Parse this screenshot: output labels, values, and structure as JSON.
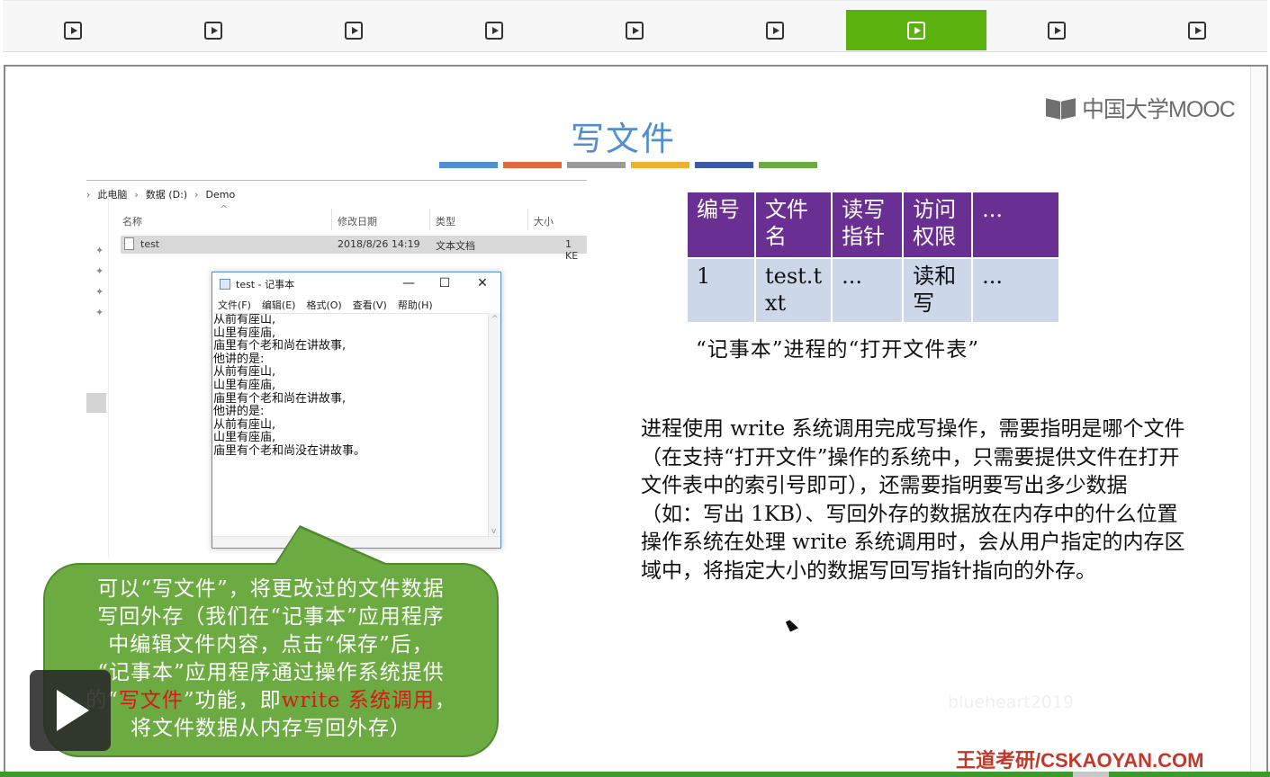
{
  "toolbar": {
    "buttons": [
      {
        "icon": "play-icon",
        "active": false
      },
      {
        "icon": "play-icon",
        "active": false
      },
      {
        "icon": "play-icon",
        "active": false
      },
      {
        "icon": "play-icon",
        "active": false
      },
      {
        "icon": "play-icon",
        "active": false
      },
      {
        "icon": "play-icon",
        "active": false
      },
      {
        "icon": "play-icon",
        "active": true
      },
      {
        "icon": "play-icon",
        "active": false
      },
      {
        "icon": "play-icon",
        "active": false
      }
    ],
    "active_color": "#5bb20e"
  },
  "slide": {
    "title": "写文件",
    "title_color": "#4f8fd0",
    "title_bar_colors": [
      "#4f8fd0",
      "#e06a3c",
      "#9a9a9a",
      "#f0b030",
      "#3a5aa8",
      "#6cab42"
    ],
    "logo": "中国大学MOOC",
    "explorer": {
      "breadcrumb": [
        "此电脑",
        "数据 (D:)",
        "Demo"
      ],
      "columns": {
        "name": "名称",
        "modified": "修改日期",
        "type": "类型",
        "size": "大小"
      },
      "file": {
        "name": "test",
        "modified": "2018/8/26 14:19",
        "type": "文本文档",
        "size": "1 KE"
      }
    },
    "notepad": {
      "title": "test - 记事本",
      "menu": [
        "文件(F)",
        "编辑(E)",
        "格式(O)",
        "查看(V)",
        "帮助(H)"
      ],
      "controls": {
        "minimize": "—",
        "maximize": "☐",
        "close": "✕"
      },
      "content": "从前有座山,\n山里有座庙,\n庙里有个老和尚在讲故事,\n他讲的是:\n从前有座山,\n山里有座庙,\n庙里有个老和尚在讲故事,\n他讲的是:\n从前有座山,\n山里有座庙,\n庙里有个老和尚没在讲故事。"
    },
    "callout": {
      "line1": "可以“写文件”，将更改过的文件数据",
      "line2": "写回外存（我们在“记事本”应用程序",
      "line3": "中编辑文件内容，点击“保存”后，",
      "line4": "“记事本”应用程序通过操作系统提供",
      "line5_a": "的“",
      "line5_red1": "写文件",
      "line5_b": "”功能，即",
      "line5_red2": "write 系统调用",
      "line5_c": "，",
      "line6": "将文件数据从内存写回外存）",
      "bg_color": "#6cab42",
      "highlight_color": "#d41a1a"
    },
    "open_file_table": {
      "headers": [
        "编号",
        "文件名",
        "读写指针",
        "访问权限",
        "..."
      ],
      "header_display": [
        "编号",
        "文件\n名",
        "读写\n指针",
        "访问\n权限",
        "..."
      ],
      "rows": [
        [
          "1",
          "test.txt",
          "...",
          "读和写",
          "..."
        ]
      ],
      "row_display": [
        [
          "1",
          "test.t\nxt",
          "...",
          "读和\n写",
          "..."
        ]
      ],
      "header_color": "#6a2f92",
      "cell_color": "#ccd8ea",
      "caption": "“记事本”进程的“打开文件表”"
    },
    "description": {
      "p1": "进程使用 write 系统调用完成写操作，需要指明是哪个文件（在支持“打开文件”操作的系统中，只需要提供文件在打开文件表中的索引号即可），还需要指明要写出多少数据（如：写出 1KB）、写回外存的数据放在内存中的什么位置",
      "p2": "操作系统在处理 write 系统调用时，会从用户指定的内存区域中，将指定大小的数据写回写指针指向的外存。"
    },
    "watermark": "blueheart2019",
    "footer": "王道考研/CSKAOYAN.COM"
  }
}
